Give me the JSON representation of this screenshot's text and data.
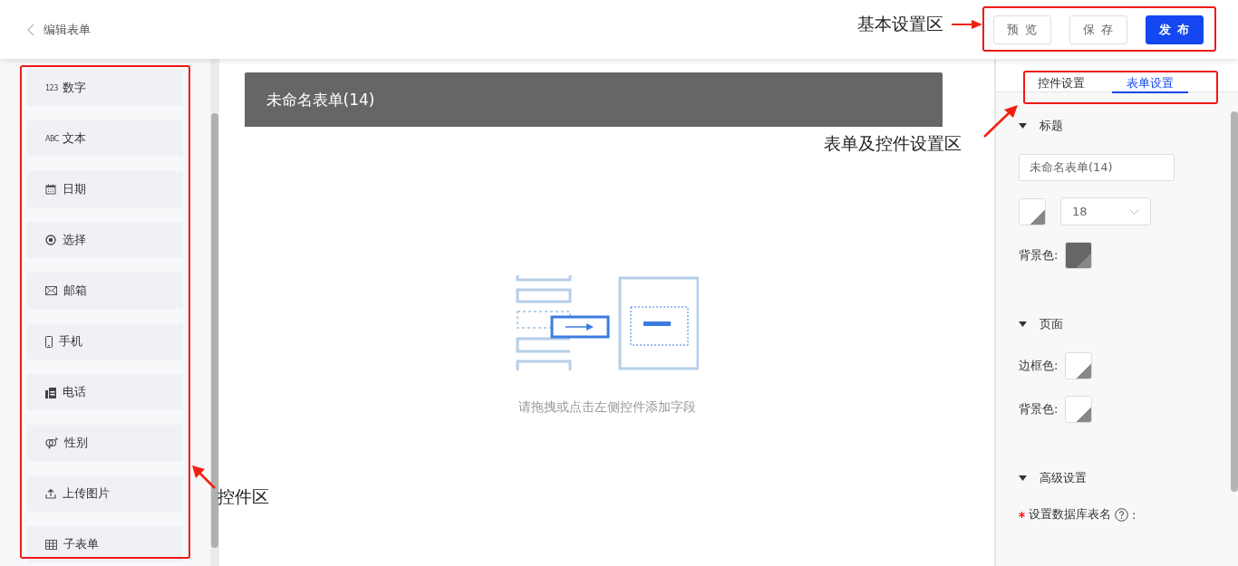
{
  "header": {
    "back_label": "编辑表单",
    "buttons": [
      {
        "label": "预 览",
        "kind": "plain"
      },
      {
        "label": "保 存",
        "kind": "plain"
      },
      {
        "label": "发 布",
        "kind": "primary"
      }
    ]
  },
  "palette": [
    {
      "label": "数字",
      "kind": "glyph",
      "glyph": "123"
    },
    {
      "label": "文本",
      "kind": "glyph",
      "glyph": "ABC"
    },
    {
      "label": "日期",
      "kind": "date"
    },
    {
      "label": "选择",
      "kind": "choice"
    },
    {
      "label": "邮箱",
      "kind": "email"
    },
    {
      "label": "手机",
      "kind": "mobile"
    },
    {
      "label": "电话",
      "kind": "phone"
    },
    {
      "label": "性别",
      "kind": "gender"
    },
    {
      "label": "上传图片",
      "kind": "upload"
    },
    {
      "label": "子表单",
      "kind": "subform"
    }
  ],
  "canvas": {
    "form_title": "未命名表单(14)",
    "empty_hint": "请拖拽或点击左侧控件添加字段"
  },
  "settings": {
    "tabs": [
      {
        "label": "控件设置",
        "selected": false
      },
      {
        "label": "表单设置",
        "selected": true
      }
    ],
    "sections": [
      {
        "kind": "title",
        "title": "标题",
        "expanded": true,
        "title_value": "未命名表单(14)",
        "font_size": "18",
        "swatches": [
          {
            "color": "#ffffff"
          },
          {
            "label": "背景色:",
            "color": "#666666"
          }
        ]
      },
      {
        "kind": "page",
        "title": "页面",
        "expanded": true,
        "swatches": [
          {
            "label": "边框色:",
            "color": "#ffffff"
          },
          {
            "label": "背景色:",
            "color": "#ffffff"
          }
        ]
      },
      {
        "kind": "advanced",
        "title": "高级设置",
        "expanded": true,
        "field_label": "设置数据库表名",
        "required": true,
        "colon": ":"
      }
    ]
  },
  "annotations": [
    {
      "kind": "buttons",
      "label": "基本设置区"
    },
    {
      "kind": "settings",
      "label": "表单及控件设置区"
    },
    {
      "kind": "palette",
      "label": "控件区"
    }
  ]
}
